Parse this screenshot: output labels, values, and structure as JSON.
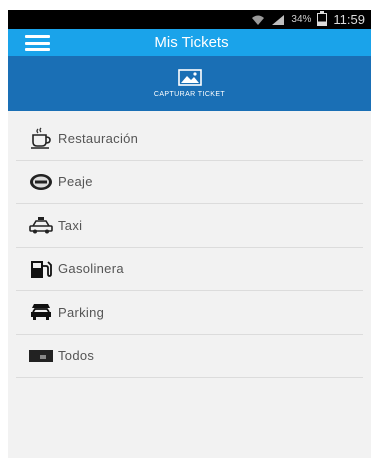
{
  "status_bar": {
    "battery": "34%",
    "time": "11:59"
  },
  "header": {
    "title": "Mis Tickets",
    "menu_icon": "hamburger-menu-icon"
  },
  "capture": {
    "label": "CAPTURAR TICKET",
    "icon": "photo-icon"
  },
  "categories": [
    {
      "label": "Restauración",
      "icon": "coffee-cup-icon"
    },
    {
      "label": "Peaje",
      "icon": "toll-icon"
    },
    {
      "label": "Taxi",
      "icon": "taxi-icon"
    },
    {
      "label": "Gasolinera",
      "icon": "fuel-pump-icon"
    },
    {
      "label": "Parking",
      "icon": "parking-car-icon"
    },
    {
      "label": "Todos",
      "icon": "wallet-icon"
    }
  ],
  "colors": {
    "topbar": "#1aa3ea",
    "capture_bar": "#1a6fb5",
    "list_background": "#f2f2f2"
  }
}
